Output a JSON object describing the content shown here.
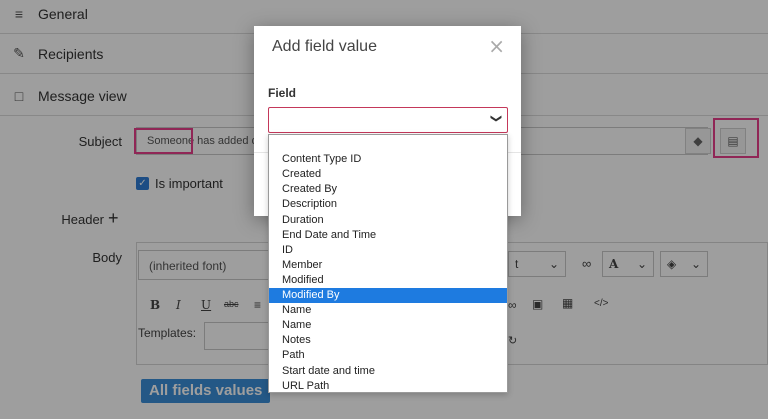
{
  "sections": {
    "general": "General",
    "recipients": "Recipients",
    "message_view": "Message view"
  },
  "form": {
    "subject_label": "Subject",
    "subject_value": "Someone has added da",
    "is_important_label": "Is important",
    "header_label": "Header",
    "header_add": "+",
    "body_label": "Body"
  },
  "editor": {
    "font_value": "(inherited font)",
    "templates_label": "Templates:",
    "format_fragment": "t",
    "highlight_letter": "A",
    "chip_label": "All fields values"
  },
  "modal": {
    "title": "Add field value",
    "field_label": "Field",
    "field_value": "",
    "options": [
      "",
      "Content Type ID",
      "Created",
      "Created By",
      "Description",
      "Duration",
      "End Date and Time",
      "ID",
      "Member",
      "Modified",
      "Modified By",
      "Name",
      "Name",
      "Notes",
      "Path",
      "Start date and time",
      "URL Path"
    ],
    "selected_index": 10
  },
  "colors": {
    "highlight_pink": "#e83e8c",
    "accent_blue": "#1e7be0",
    "chip_blue": "#3b8fd9"
  }
}
